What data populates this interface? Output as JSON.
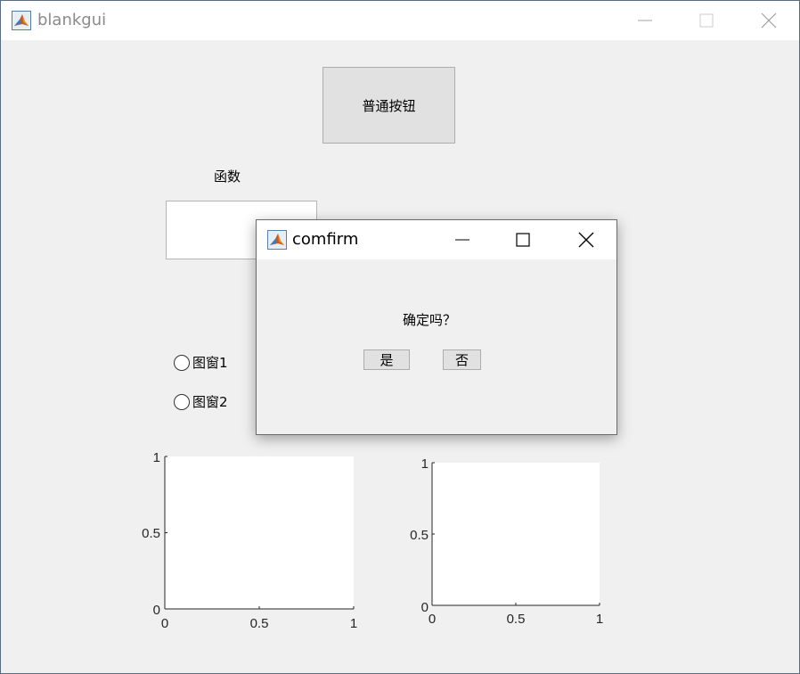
{
  "window": {
    "title": "blankgui"
  },
  "main": {
    "push_button_label": "普通按钮",
    "function_label": "函数",
    "edit_value": "",
    "radio1_label": "图窗1",
    "radio2_label": "图窗2"
  },
  "axes1": {
    "xticks": [
      "0",
      "0.5",
      "1"
    ],
    "yticks": [
      "0",
      "0.5",
      "1"
    ]
  },
  "axes2": {
    "xticks": [
      "0",
      "0.5",
      "1"
    ],
    "yticks": [
      "0",
      "0.5",
      "1"
    ]
  },
  "dialog": {
    "title": "comfirm",
    "message": "确定吗？",
    "yes_label": "是",
    "no_label": "否"
  }
}
